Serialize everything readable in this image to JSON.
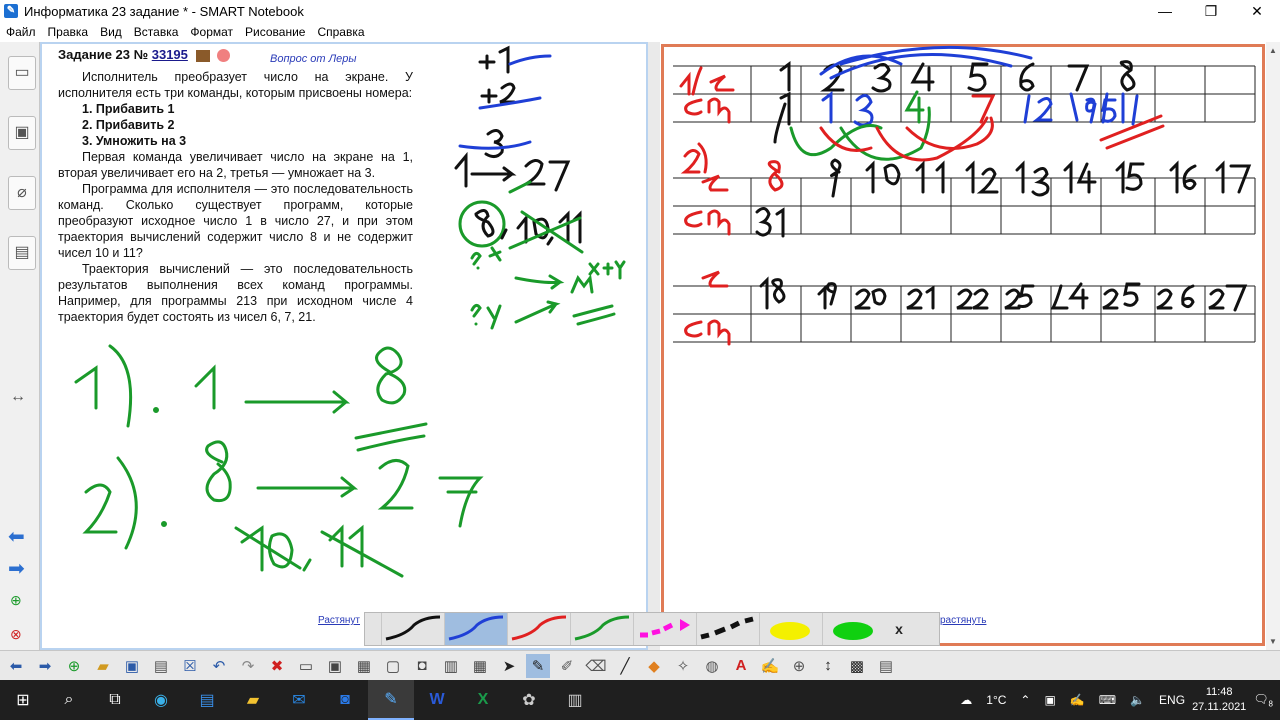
{
  "window": {
    "title": "Информатика 23 задание * - SMART Notebook",
    "minimize": "—",
    "maximize": "❐",
    "close": "✕"
  },
  "menu": [
    "Файл",
    "Правка",
    "Вид",
    "Вставка",
    "Формат",
    "Рисование",
    "Справка"
  ],
  "task": {
    "title_prefix": "Задание 23 №",
    "number": "33195",
    "question_link": "Вопрос от Леры",
    "intro": "Исполнитель преобразует число на экране. У исполнителя есть три команды, которым присвоены номера:",
    "commands": [
      "1. Прибавить 1",
      "2. Прибавить 2",
      "3. Умножить на 3"
    ],
    "p1": "Первая команда увеличивает число на экране на 1, вторая увеличивает его на 2, третья — умножает на 3.",
    "p2": "Программа для исполнителя — это последовательность команд. Сколько существует программ, которые преобразуют исходное число 1 в число 27, и при этом траектория вычислений содержит число 8 и не содержит чисел 10 и 11?",
    "p3": "Траектория вычислений — это последовательность результатов выполнения всех команд программы. Например, для программы 213 при исходном числе 4 траектория будет состоять из чисел 6, 7, 21."
  },
  "stretch_left": "Растянут",
  "stretch_right": "растянуть",
  "pen_tray": {
    "pens": [
      {
        "name": "black",
        "color": "#111111"
      },
      {
        "name": "blue",
        "color": "#1f3fd6"
      },
      {
        "name": "red",
        "color": "#e02020"
      },
      {
        "name": "green",
        "color": "#1a9a2a"
      },
      {
        "name": "magenta",
        "color": "#ff10e0"
      },
      {
        "name": "black-dashed",
        "color": "#111111"
      },
      {
        "name": "yellow-highlighter",
        "color": "#f4f000"
      },
      {
        "name": "green-highlighter",
        "color": "#10d010"
      }
    ],
    "close": "x"
  },
  "taskbar": {
    "weather": "1°C",
    "lang": "ENG",
    "time": "11:48",
    "date": "27.11.2021",
    "notifications": "8"
  }
}
